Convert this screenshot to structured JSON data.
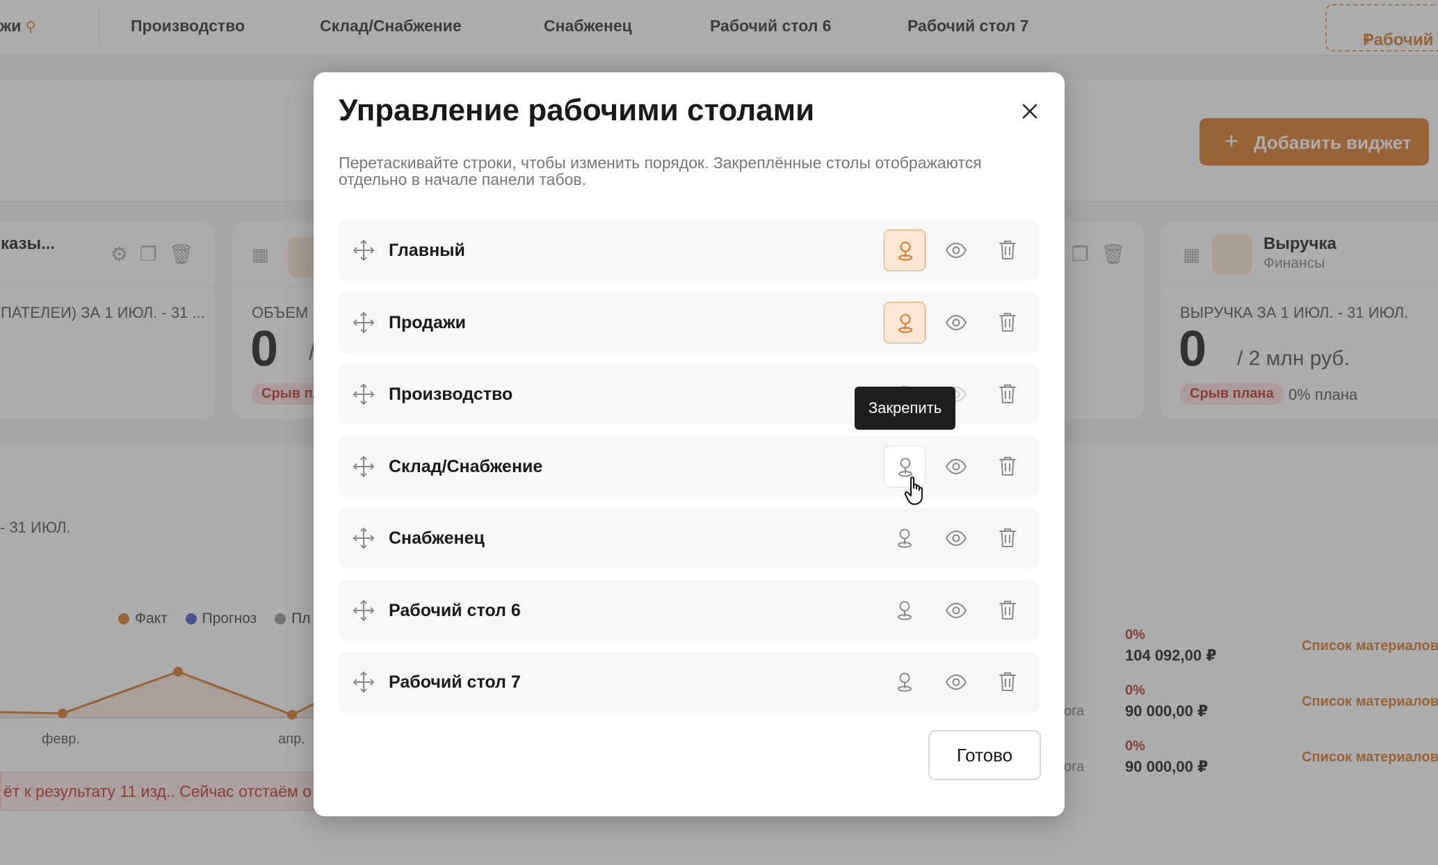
{
  "background": {
    "tabs": {
      "partial_first": "жи",
      "items": [
        "Производство",
        "Склад/Снабжение",
        "Снабженец",
        "Рабочий стол 6",
        "Рабочий стол 7"
      ],
      "add_label": "Рабочий"
    },
    "add_widget_label": "Добавить виджет",
    "card_left": {
      "title": "казы...",
      "period": "ПАТЕЛЕИ) ЗА 1 ИЮЛ. - 31 ..."
    },
    "card_mid": {
      "label": "ОБЪЕМ",
      "value": "0",
      "value_suffix": "/",
      "badge": "Срыв пл"
    },
    "card_revenue": {
      "title": "Выручка",
      "subtitle": "Финансы",
      "period": "ВЫРУЧКА ЗА 1 ИЮЛ. - 31 ИЮЛ.",
      "value": "0",
      "plan": "/ 2 млн руб.",
      "badge": "Срыв плана",
      "plan_pct": "0% плана"
    },
    "chart": {
      "period": "- 31 ИЮЛ.",
      "legend": [
        {
          "name": "Факт",
          "color": "#d97a2b"
        },
        {
          "name": "Прогноз",
          "color": "#4a5bd4"
        },
        {
          "name": "Пл",
          "color": "#999999"
        }
      ],
      "xticks": [
        "февр.",
        "апр."
      ]
    },
    "alert_text": "ёт к результату 11 изд.. Сейчас отстаём о",
    "table_rows": [
      {
        "pct": "0%",
        "amount": "104 092,00 ₽",
        "link": "Список материалов",
        "note": ""
      },
      {
        "pct": "0%",
        "amount": "90 000,00 ₽",
        "link": "Список материалов",
        "note": "ога"
      },
      {
        "pct": "0%",
        "amount": "90 000,00 ₽",
        "link": "Список материалов",
        "note": "ога"
      }
    ]
  },
  "modal": {
    "title": "Управление рабочими столами",
    "description": "Перетаскивайте строки, чтобы изменить порядок. Закреплённые столы отображаются отдельно в начале панели табов.",
    "rows": [
      {
        "name": "Главный",
        "pinned": true
      },
      {
        "name": "Продажи",
        "pinned": true
      },
      {
        "name": "Производство",
        "pinned": false
      },
      {
        "name": "Склад/Снабжение",
        "pinned": false
      },
      {
        "name": "Снабженец",
        "pinned": false
      },
      {
        "name": "Рабочий стол 6",
        "pinned": false
      },
      {
        "name": "Рабочий стол 7",
        "pinned": false
      }
    ],
    "tooltip": "Закрепить",
    "done_label": "Готово"
  },
  "colors": {
    "accent": "#d97a2b",
    "accent_soft": "#fce6d4",
    "danger": "#c0392b",
    "icon_grey": "#8a8a8a"
  },
  "icons": {
    "drag": "move-arrows-icon",
    "pin": "pin-icon",
    "visibility": "eye-icon",
    "delete": "trash-icon",
    "close": "close-icon"
  }
}
